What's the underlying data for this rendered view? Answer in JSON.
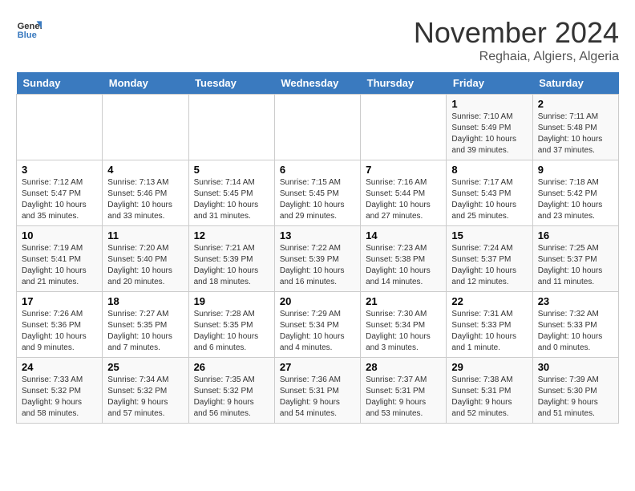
{
  "logo": {
    "line1": "General",
    "line2": "Blue"
  },
  "title": "November 2024",
  "subtitle": "Reghaia, Algiers, Algeria",
  "weekdays": [
    "Sunday",
    "Monday",
    "Tuesday",
    "Wednesday",
    "Thursday",
    "Friday",
    "Saturday"
  ],
  "weeks": [
    [
      {
        "day": "",
        "info": ""
      },
      {
        "day": "",
        "info": ""
      },
      {
        "day": "",
        "info": ""
      },
      {
        "day": "",
        "info": ""
      },
      {
        "day": "",
        "info": ""
      },
      {
        "day": "1",
        "info": "Sunrise: 7:10 AM\nSunset: 5:49 PM\nDaylight: 10 hours and 39 minutes."
      },
      {
        "day": "2",
        "info": "Sunrise: 7:11 AM\nSunset: 5:48 PM\nDaylight: 10 hours and 37 minutes."
      }
    ],
    [
      {
        "day": "3",
        "info": "Sunrise: 7:12 AM\nSunset: 5:47 PM\nDaylight: 10 hours and 35 minutes."
      },
      {
        "day": "4",
        "info": "Sunrise: 7:13 AM\nSunset: 5:46 PM\nDaylight: 10 hours and 33 minutes."
      },
      {
        "day": "5",
        "info": "Sunrise: 7:14 AM\nSunset: 5:45 PM\nDaylight: 10 hours and 31 minutes."
      },
      {
        "day": "6",
        "info": "Sunrise: 7:15 AM\nSunset: 5:45 PM\nDaylight: 10 hours and 29 minutes."
      },
      {
        "day": "7",
        "info": "Sunrise: 7:16 AM\nSunset: 5:44 PM\nDaylight: 10 hours and 27 minutes."
      },
      {
        "day": "8",
        "info": "Sunrise: 7:17 AM\nSunset: 5:43 PM\nDaylight: 10 hours and 25 minutes."
      },
      {
        "day": "9",
        "info": "Sunrise: 7:18 AM\nSunset: 5:42 PM\nDaylight: 10 hours and 23 minutes."
      }
    ],
    [
      {
        "day": "10",
        "info": "Sunrise: 7:19 AM\nSunset: 5:41 PM\nDaylight: 10 hours and 21 minutes."
      },
      {
        "day": "11",
        "info": "Sunrise: 7:20 AM\nSunset: 5:40 PM\nDaylight: 10 hours and 20 minutes."
      },
      {
        "day": "12",
        "info": "Sunrise: 7:21 AM\nSunset: 5:39 PM\nDaylight: 10 hours and 18 minutes."
      },
      {
        "day": "13",
        "info": "Sunrise: 7:22 AM\nSunset: 5:39 PM\nDaylight: 10 hours and 16 minutes."
      },
      {
        "day": "14",
        "info": "Sunrise: 7:23 AM\nSunset: 5:38 PM\nDaylight: 10 hours and 14 minutes."
      },
      {
        "day": "15",
        "info": "Sunrise: 7:24 AM\nSunset: 5:37 PM\nDaylight: 10 hours and 12 minutes."
      },
      {
        "day": "16",
        "info": "Sunrise: 7:25 AM\nSunset: 5:37 PM\nDaylight: 10 hours and 11 minutes."
      }
    ],
    [
      {
        "day": "17",
        "info": "Sunrise: 7:26 AM\nSunset: 5:36 PM\nDaylight: 10 hours and 9 minutes."
      },
      {
        "day": "18",
        "info": "Sunrise: 7:27 AM\nSunset: 5:35 PM\nDaylight: 10 hours and 7 minutes."
      },
      {
        "day": "19",
        "info": "Sunrise: 7:28 AM\nSunset: 5:35 PM\nDaylight: 10 hours and 6 minutes."
      },
      {
        "day": "20",
        "info": "Sunrise: 7:29 AM\nSunset: 5:34 PM\nDaylight: 10 hours and 4 minutes."
      },
      {
        "day": "21",
        "info": "Sunrise: 7:30 AM\nSunset: 5:34 PM\nDaylight: 10 hours and 3 minutes."
      },
      {
        "day": "22",
        "info": "Sunrise: 7:31 AM\nSunset: 5:33 PM\nDaylight: 10 hours and 1 minute."
      },
      {
        "day": "23",
        "info": "Sunrise: 7:32 AM\nSunset: 5:33 PM\nDaylight: 10 hours and 0 minutes."
      }
    ],
    [
      {
        "day": "24",
        "info": "Sunrise: 7:33 AM\nSunset: 5:32 PM\nDaylight: 9 hours and 58 minutes."
      },
      {
        "day": "25",
        "info": "Sunrise: 7:34 AM\nSunset: 5:32 PM\nDaylight: 9 hours and 57 minutes."
      },
      {
        "day": "26",
        "info": "Sunrise: 7:35 AM\nSunset: 5:32 PM\nDaylight: 9 hours and 56 minutes."
      },
      {
        "day": "27",
        "info": "Sunrise: 7:36 AM\nSunset: 5:31 PM\nDaylight: 9 hours and 54 minutes."
      },
      {
        "day": "28",
        "info": "Sunrise: 7:37 AM\nSunset: 5:31 PM\nDaylight: 9 hours and 53 minutes."
      },
      {
        "day": "29",
        "info": "Sunrise: 7:38 AM\nSunset: 5:31 PM\nDaylight: 9 hours and 52 minutes."
      },
      {
        "day": "30",
        "info": "Sunrise: 7:39 AM\nSunset: 5:30 PM\nDaylight: 9 hours and 51 minutes."
      }
    ]
  ]
}
